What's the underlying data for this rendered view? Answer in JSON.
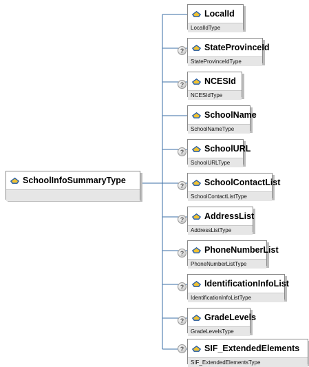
{
  "root": {
    "name": "SchoolInfoSummaryType"
  },
  "optional_marker": "?",
  "elements": [
    {
      "name": "LocalId",
      "type": "LocalIdType",
      "optional": false
    },
    {
      "name": "StateProvinceId",
      "type": "StateProvinceIdType",
      "optional": true
    },
    {
      "name": "NCESId",
      "type": "NCESIdType",
      "optional": true
    },
    {
      "name": "SchoolName",
      "type": "SchoolNameType",
      "optional": false
    },
    {
      "name": "SchoolURL",
      "type": "SchoolURLType",
      "optional": true
    },
    {
      "name": "SchoolContactList",
      "type": "SchoolContactListType",
      "optional": true
    },
    {
      "name": "AddressList",
      "type": "AddressListType",
      "optional": true
    },
    {
      "name": "PhoneNumberList",
      "type": "PhoneNumberListType",
      "optional": true
    },
    {
      "name": "IdentificationInfoList",
      "type": "IdentificationInfoListType",
      "optional": true
    },
    {
      "name": "GradeLevels",
      "type": "GradeLevelsType",
      "optional": true
    },
    {
      "name": "SIF_ExtendedElements",
      "type": "SIF_ExtendedElementsType",
      "optional": true
    }
  ]
}
